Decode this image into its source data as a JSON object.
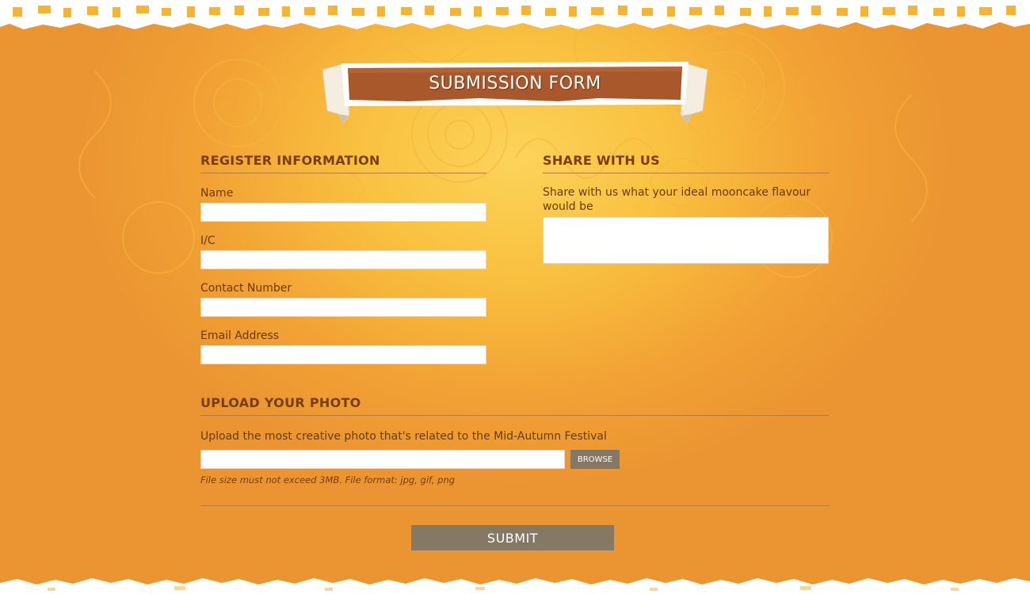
{
  "banner": {
    "title": "SUBMISSION FORM"
  },
  "register": {
    "heading": "REGISTER INFORMATION",
    "fields": [
      {
        "label": "Name",
        "value": ""
      },
      {
        "label": "I/C",
        "value": ""
      },
      {
        "label": "Contact Number",
        "value": ""
      },
      {
        "label": "Email Address",
        "value": ""
      }
    ]
  },
  "share": {
    "heading": "SHARE WITH US",
    "prompt": "Share with us what your ideal mooncake flavour would be",
    "value": ""
  },
  "upload": {
    "heading": "UPLOAD YOUR PHOTO",
    "description": "Upload the most creative photo that's related to the Mid-Autumn Festival",
    "file_value": "",
    "browse_label": "BROWSE",
    "hint": "File size must not exceed 3MB. File format: jpg, gif, png"
  },
  "submit_label": "SUBMIT",
  "colors": {
    "background_light": "#fcd35a",
    "background_dark": "#ea9432",
    "banner_ribbon": "#a9582b",
    "heading_text": "#7a3d0f",
    "button": "#857864"
  }
}
